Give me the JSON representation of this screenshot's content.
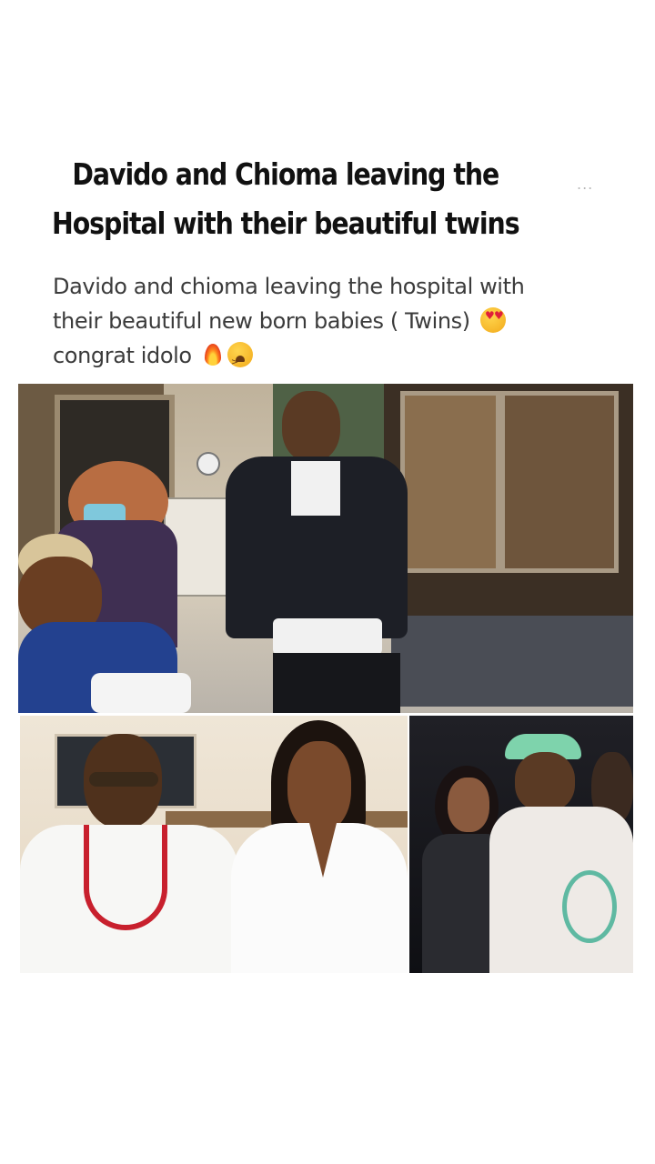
{
  "post": {
    "headline": "Davido and Chioma leaving the Hospital with their beautiful twins",
    "more_label": "..."
  },
  "tweet": {
    "text_line1": "Davido and chioma leaving the hospital with",
    "text_line2": "their beautiful new born babies ( Twins)",
    "text_line3": "congrat idolo"
  },
  "emojis": {
    "line2_end": "smiling-face-with-heart-eyes",
    "line3_a": "fire",
    "line3_b": "weary-face"
  },
  "photos": [
    {
      "name": "hospital-exit-photo"
    },
    {
      "name": "couple-white-outfits-photo"
    },
    {
      "name": "couple-night-out-photo"
    }
  ],
  "colors": {
    "text": "#111111",
    "tweet_text": "#3b3b3b",
    "more_dots": "#b7b7b7"
  }
}
